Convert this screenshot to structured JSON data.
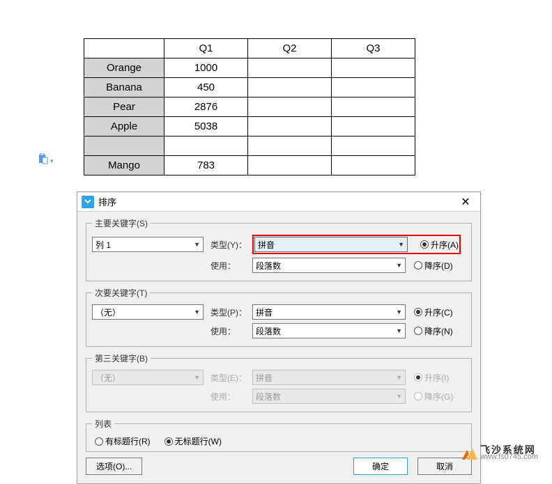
{
  "table": {
    "headers": [
      "",
      "Q1",
      "Q2",
      "Q3"
    ],
    "rows": [
      {
        "name": "Orange",
        "q1": "1000",
        "q2": "",
        "q3": ""
      },
      {
        "name": "Banana",
        "q1": "450",
        "q2": "",
        "q3": ""
      },
      {
        "name": "Pear",
        "q1": "2876",
        "q2": "",
        "q3": ""
      },
      {
        "name": "Apple",
        "q1": "5038",
        "q2": "",
        "q3": ""
      },
      {
        "name": "",
        "q1": "",
        "q2": "",
        "q3": ""
      },
      {
        "name": "Mango",
        "q1": "783",
        "q2": "",
        "q3": ""
      }
    ]
  },
  "dialog": {
    "title": "排序",
    "primary": {
      "legend": "主要关键字(S)",
      "column": "列 1",
      "type_label": "类型(Y)：",
      "type_value": "拼音",
      "use_label": "使用：",
      "use_value": "段落数",
      "asc_label": "升序(A)",
      "desc_label": "降序(D)"
    },
    "secondary": {
      "legend": "次要关键字(T)",
      "column": "（无）",
      "type_label": "类型(P)：",
      "type_value": "拼音",
      "use_label": "使用：",
      "use_value": "段落数",
      "asc_label": "升序(C)",
      "desc_label": "降序(N)"
    },
    "tertiary": {
      "legend": "第三关键字(B)",
      "column": "（无）",
      "type_label": "类型(E)：",
      "type_value": "拼音",
      "use_label": "使用：",
      "use_value": "段落数",
      "asc_label": "升序(I)",
      "desc_label": "降序(G)"
    },
    "list": {
      "legend": "列表",
      "has_header": "有标题行(R)",
      "no_header": "无标题行(W)"
    },
    "buttons": {
      "options": "选项(O)...",
      "ok": "确定",
      "cancel": "取消"
    }
  },
  "brand": {
    "name": "飞沙系统网",
    "url": "www.fs0745.com"
  }
}
